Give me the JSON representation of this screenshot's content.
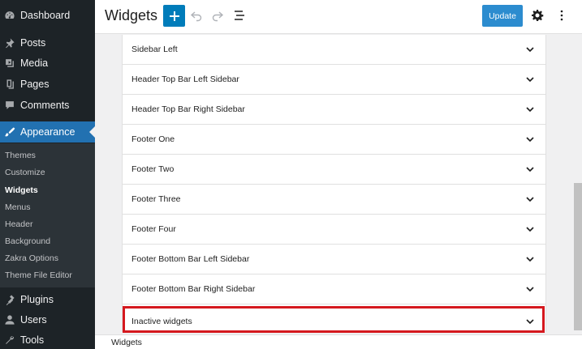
{
  "sidebar": {
    "items": [
      {
        "label": "Dashboard",
        "icon": "dashboard-icon"
      },
      {
        "label": "Posts",
        "icon": "pin-icon"
      },
      {
        "label": "Media",
        "icon": "media-icon"
      },
      {
        "label": "Pages",
        "icon": "pages-icon"
      },
      {
        "label": "Comments",
        "icon": "comment-icon"
      },
      {
        "label": "Appearance",
        "icon": "brush-icon"
      },
      {
        "label": "Plugins",
        "icon": "plugin-icon"
      },
      {
        "label": "Users",
        "icon": "user-icon"
      },
      {
        "label": "Tools",
        "icon": "wrench-icon"
      }
    ],
    "submenu": [
      "Themes",
      "Customize",
      "Widgets",
      "Menus",
      "Header",
      "Background",
      "Zakra Options",
      "Theme File Editor"
    ]
  },
  "header": {
    "title": "Widgets",
    "update_label": "Update"
  },
  "widget_areas": [
    "Sidebar Left",
    "Header Top Bar Left Sidebar",
    "Header Top Bar Right Sidebar",
    "Footer One",
    "Footer Two",
    "Footer Three",
    "Footer Four",
    "Footer Bottom Bar Left Sidebar",
    "Footer Bottom Bar Right Sidebar",
    "Inactive widgets"
  ],
  "footer": {
    "breadcrumb": "Widgets"
  },
  "colors": {
    "sidebar_bg": "#1d2327",
    "accent": "#2271b1",
    "highlight_border": "#d5181e",
    "update_btn": "#2c8ccf"
  }
}
